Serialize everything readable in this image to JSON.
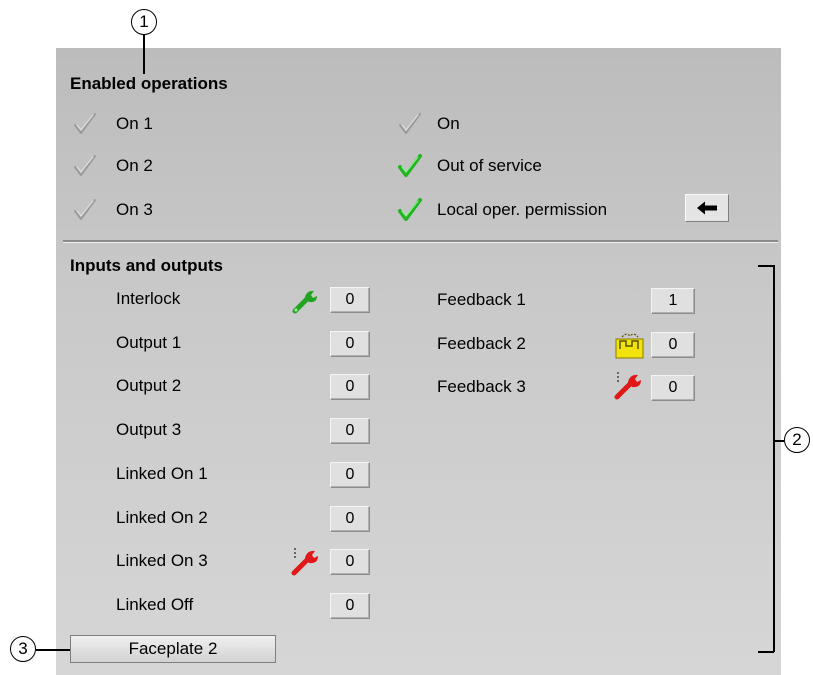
{
  "callouts": [
    "1",
    "2",
    "3"
  ],
  "enabled_operations": {
    "heading": "Enabled operations",
    "left": [
      {
        "label": "On 1",
        "state": "inactive"
      },
      {
        "label": "On 2",
        "state": "inactive"
      },
      {
        "label": "On 3",
        "state": "inactive"
      }
    ],
    "right": [
      {
        "label": "On",
        "state": "inactive"
      },
      {
        "label": "Out of service",
        "state": "active"
      },
      {
        "label": "Local oper. permission",
        "state": "active"
      }
    ],
    "colors": {
      "active_check": "#22b422",
      "inactive_check": "#9a9a9a"
    }
  },
  "inputs_outputs": {
    "heading": "Inputs and outputs",
    "left": [
      {
        "label": "Interlock",
        "value": "0",
        "icon": "green-wrench-icon"
      },
      {
        "label": "Output 1",
        "value": "0"
      },
      {
        "label": "Output 2",
        "value": "0"
      },
      {
        "label": "Output 3",
        "value": "0"
      },
      {
        "label": "Linked On 1",
        "value": "0"
      },
      {
        "label": "Linked On 2",
        "value": "0"
      },
      {
        "label": "Linked On 3",
        "value": "0",
        "icon": "red-wrench-icon"
      },
      {
        "label": "Linked Off",
        "value": "0"
      }
    ],
    "right": [
      {
        "label": "Feedback 1",
        "value": "1"
      },
      {
        "label": "Feedback 2",
        "value": "0",
        "icon": "simulation-icon"
      },
      {
        "label": "Feedback 3",
        "value": "0",
        "icon": "red-wrench-icon"
      }
    ]
  },
  "buttons": {
    "faceplate": "Faceplate 2",
    "arrow_icon": "left-arrow-icon"
  }
}
